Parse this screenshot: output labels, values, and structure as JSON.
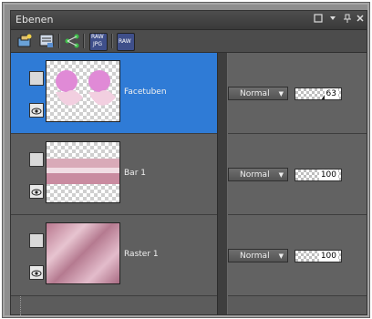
{
  "panel": {
    "title": "Ebenen"
  },
  "toolbar": {
    "raw_jpg_top": "RAW",
    "raw_jpg_bottom": "JPG",
    "raw2": "RAW"
  },
  "layers": [
    {
      "name": "Facetuben",
      "blend": "Normal",
      "opacity": "63",
      "selected": true
    },
    {
      "name": "Bar 1",
      "blend": "Normal",
      "opacity": "100",
      "selected": false
    },
    {
      "name": "Raster 1",
      "blend": "Normal",
      "opacity": "100",
      "selected": false
    }
  ],
  "colors": {
    "selection": "#2f7bd6",
    "panel": "#5a5a5a",
    "pink": "#c98ba0"
  }
}
